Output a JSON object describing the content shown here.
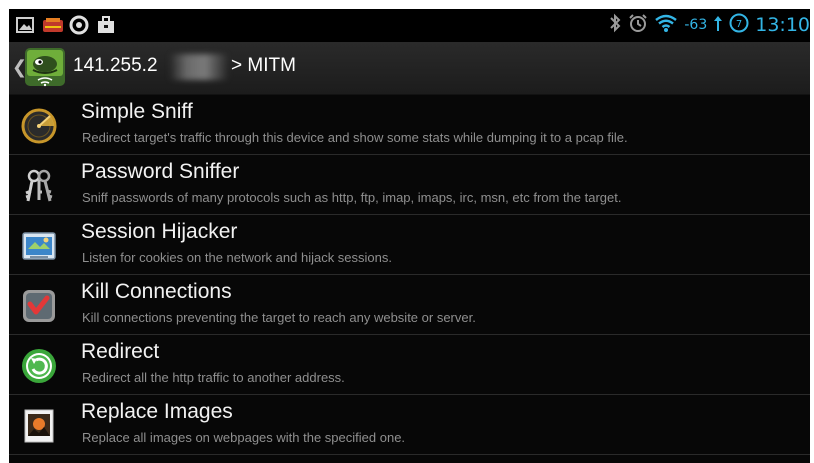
{
  "status_bar": {
    "icons_left": [
      "picture-icon",
      "card-icon",
      "circle-o-icon",
      "briefcase-icon"
    ],
    "icons_right": [
      "bluetooth-icon",
      "alarm-icon",
      "wifi-icon"
    ],
    "signal": "-63",
    "time": "13:10"
  },
  "action_bar": {
    "title_prefix": "141.255.2",
    "title_suffix": "> MITM"
  },
  "menu": {
    "items": [
      {
        "title": "Simple Sniff",
        "description": "Redirect target's traffic through this device and show some stats while dumping it to a pcap file.",
        "icon": "radar-icon"
      },
      {
        "title": "Password Sniffer",
        "description": "Sniff passwords of many protocols such as http, ftp, imap, imaps, irc, msn, etc from the target.",
        "icon": "keys-icon"
      },
      {
        "title": "Session Hijacker",
        "description": "Listen for cookies on the network and hijack sessions.",
        "icon": "session-icon"
      },
      {
        "title": "Kill Connections",
        "description": "Kill connections preventing the target to reach any website or server.",
        "icon": "kill-icon"
      },
      {
        "title": "Redirect",
        "description": "Redirect all the http traffic to another address.",
        "icon": "redirect-icon"
      },
      {
        "title": "Replace Images",
        "description": "Replace all images on webpages with the specified one.",
        "icon": "image-icon"
      }
    ]
  }
}
